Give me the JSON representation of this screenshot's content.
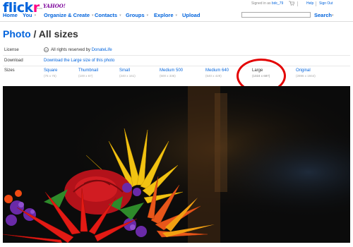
{
  "brand": {
    "logo_flick": "flick",
    "logo_r": "r",
    "from": "from",
    "yahoo": "YAHOO!"
  },
  "account": {
    "signed_in_prefix": "Signed in as",
    "username": "bdc_79",
    "help": "Help",
    "sign_out": "Sign Out"
  },
  "nav": {
    "items": [
      {
        "label": "Home"
      },
      {
        "label": "You"
      },
      {
        "label": "Organize & Create"
      },
      {
        "label": "Contacts"
      },
      {
        "label": "Groups"
      },
      {
        "label": "Explore"
      },
      {
        "label": "Upload"
      }
    ],
    "search_label": "Search",
    "search_value": ""
  },
  "page": {
    "title_link": "Photo",
    "title_rest": " / All sizes"
  },
  "info": {
    "license_label": "License",
    "cc_icon": "cc",
    "license_text": "All rights reserved by",
    "license_owner": "DonateLife",
    "download_label": "Download",
    "download_link": "Download the Large size of this photo",
    "sizes_label": "Sizes"
  },
  "sizes": [
    {
      "name": "Square",
      "dims": "(75 x 75)"
    },
    {
      "name": "Thumbnail",
      "dims": "(100 x 67)"
    },
    {
      "name": "Small",
      "dims": "(240 x 161)"
    },
    {
      "name": "Medium 500",
      "dims": "(500 x 336)"
    },
    {
      "name": "Medium 640",
      "dims": "(640 x 429)"
    },
    {
      "name": "Large",
      "dims": "(1024 x 687)",
      "selected": true
    },
    {
      "name": "Original",
      "dims": "(2896 x 1944)"
    }
  ],
  "icons": {
    "cart": "cart-icon",
    "caret": "caret-down-icon"
  },
  "colors": {
    "link": "#0063dc",
    "flickr_pink": "#ff0084",
    "yahoo_purple": "#7b0099",
    "highlight": "#e30000"
  }
}
